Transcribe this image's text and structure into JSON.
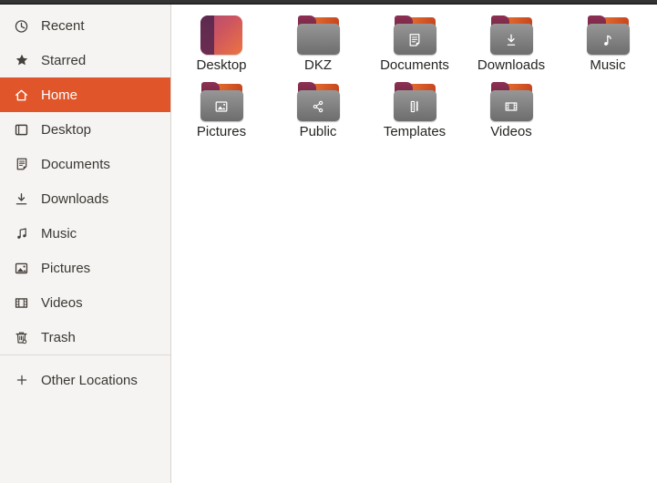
{
  "sidebar": {
    "items": [
      {
        "label": "Recent",
        "icon": "recent-icon",
        "selected": false
      },
      {
        "label": "Starred",
        "icon": "star-icon",
        "selected": false
      },
      {
        "label": "Home",
        "icon": "home-icon",
        "selected": true
      },
      {
        "label": "Desktop",
        "icon": "desktop-icon",
        "selected": false
      },
      {
        "label": "Documents",
        "icon": "documents-icon",
        "selected": false
      },
      {
        "label": "Downloads",
        "icon": "downloads-icon",
        "selected": false
      },
      {
        "label": "Music",
        "icon": "music-icon",
        "selected": false
      },
      {
        "label": "Pictures",
        "icon": "pictures-icon",
        "selected": false
      },
      {
        "label": "Videos",
        "icon": "videos-icon",
        "selected": false
      },
      {
        "label": "Trash",
        "icon": "trash-icon",
        "selected": false
      }
    ],
    "footer_item": {
      "label": "Other Locations",
      "icon": "plus-icon"
    }
  },
  "files": {
    "items": [
      {
        "name": "Desktop",
        "kind": "desktop-special",
        "emblem": ""
      },
      {
        "name": "DKZ",
        "kind": "folder",
        "emblem": ""
      },
      {
        "name": "Documents",
        "kind": "folder",
        "emblem": "document-emblem"
      },
      {
        "name": "Downloads",
        "kind": "folder",
        "emblem": "download-emblem"
      },
      {
        "name": "Music",
        "kind": "folder",
        "emblem": "music-emblem"
      },
      {
        "name": "Pictures",
        "kind": "folder",
        "emblem": "image-emblem"
      },
      {
        "name": "Public",
        "kind": "folder",
        "emblem": "share-emblem"
      },
      {
        "name": "Templates",
        "kind": "folder",
        "emblem": "template-emblem"
      },
      {
        "name": "Videos",
        "kind": "folder",
        "emblem": "video-emblem"
      }
    ]
  },
  "colors": {
    "accent_orange": "#e0562a",
    "topbar": "#2d2d2d",
    "sidebar_bg": "#f6f4f2",
    "sidebar_border": "#d8d4d0",
    "main_bg": "#ffffff",
    "folder_front_light": "#959595",
    "folder_front_dark": "#6d6d6d",
    "folder_back_orange_light": "#ef7d36",
    "folder_back_orange_dark": "#c6451f",
    "folder_tab_maroon": "#7b2847",
    "desktop_icon_purple": "#5e2a50",
    "desktop_icon_pink": "#b14a76",
    "desktop_icon_orange": "#ec7441"
  }
}
